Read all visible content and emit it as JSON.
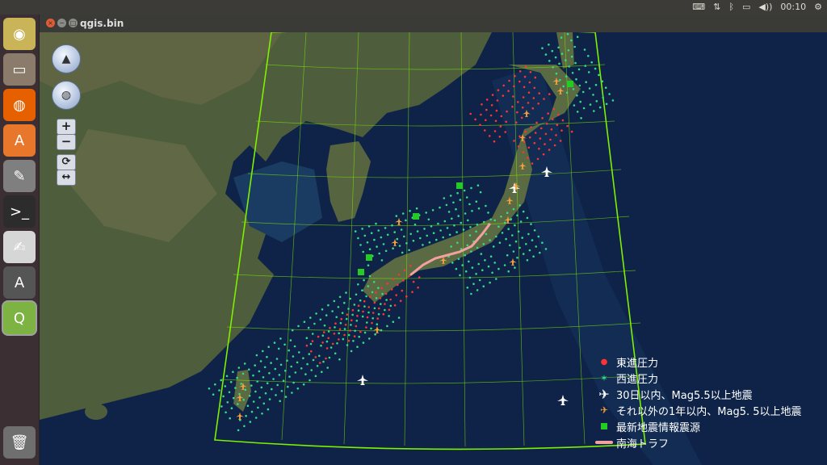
{
  "system_bar": {
    "time": "00:10",
    "volume_symbol": "◀))",
    "icons": [
      "keyboard-icon",
      "network-arrows-icon",
      "bluetooth-icon",
      "battery-icon",
      "volume-icon",
      "gear-icon"
    ]
  },
  "launcher": {
    "items": [
      {
        "name": "ubuntu-dash-icon",
        "color": "#c9b458",
        "glyph": "◉"
      },
      {
        "name": "files-icon",
        "color": "#8b7b6b",
        "glyph": "▭"
      },
      {
        "name": "firefox-icon",
        "color": "#e66000",
        "glyph": "◍"
      },
      {
        "name": "software-center-icon",
        "color": "#e9772b",
        "glyph": "A"
      },
      {
        "name": "settings-icon",
        "color": "#7f7f7f",
        "glyph": "✎"
      },
      {
        "name": "terminal-icon",
        "color": "#2c2c2c",
        "glyph": ">_"
      },
      {
        "name": "text-editor-icon",
        "color": "#d6d6d6",
        "glyph": "✍"
      },
      {
        "name": "software-updater-icon",
        "color": "#555555",
        "glyph": "A"
      },
      {
        "name": "qgis-icon",
        "color": "#7cb342",
        "glyph": "Q"
      },
      {
        "name": "trash-icon",
        "color": "#6f6f6f",
        "glyph": "🗑"
      }
    ]
  },
  "window": {
    "title": "qgis.bin"
  },
  "map_controls": {
    "pan_icon": "person-icon",
    "globe_icon": "globe-icon",
    "zoom_in": "+",
    "zoom_out": "−",
    "refresh": "⟳",
    "fit": "↔"
  },
  "legend": {
    "items": [
      {
        "label": "東進圧力",
        "symbol": "red-dot",
        "color": "#ff3333"
      },
      {
        "label": "西進圧力",
        "symbol": "green-star",
        "color": "#33dd88"
      },
      {
        "label": "30日以内、Mag5.5以上地震",
        "symbol": "white-plane",
        "color": "#ffffff"
      },
      {
        "label": "それ以外の1年以内、Mag5. 5以上地震",
        "symbol": "orange-plane",
        "color": "#f0a040"
      },
      {
        "label": "最新地震情報震源",
        "symbol": "green-square",
        "color": "#22cc22"
      },
      {
        "label": "南海トラフ",
        "symbol": "pink-line",
        "color": "#f3a0a0"
      }
    ]
  },
  "colors": {
    "graticule": "#7ef000",
    "ocean": "#0e2347",
    "land": "#4b5a3a",
    "trough": "#f3a0a0"
  }
}
